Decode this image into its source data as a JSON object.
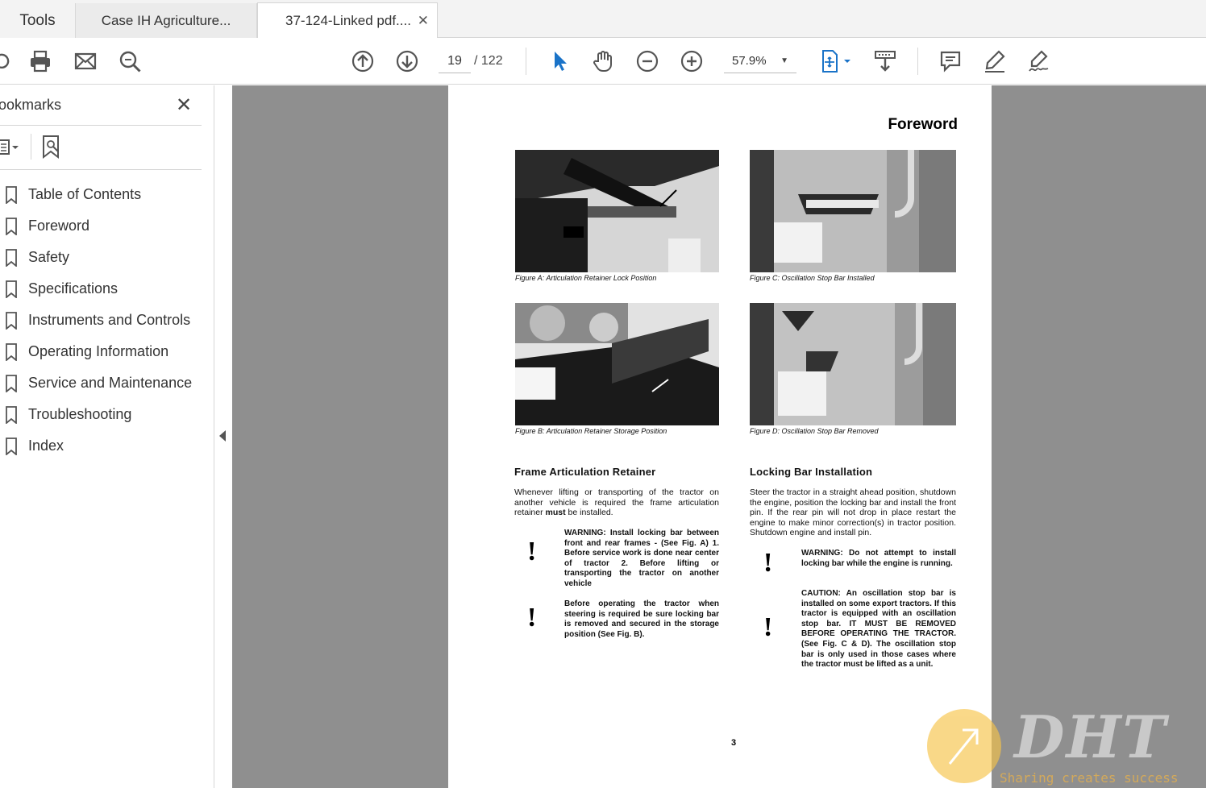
{
  "tabs": [
    {
      "label": "Tools"
    },
    {
      "label": "Case IH Agriculture..."
    },
    {
      "label": "37-124-Linked pdf...."
    }
  ],
  "toolbar": {
    "page_current": "19",
    "page_total": "/ 122",
    "zoom": "57.9%",
    "icons": [
      "share-icon",
      "print-icon",
      "email-icon",
      "search-zoom-icon",
      "page-up-icon",
      "page-down-icon",
      "select-tool-icon",
      "hand-tool-icon",
      "zoom-out-icon",
      "zoom-in-icon",
      "fit-page-icon",
      "scroll-mode-icon",
      "comment-icon",
      "highlight-icon",
      "sign-icon"
    ]
  },
  "sidebar": {
    "title": "ookmarks",
    "bookmarks": [
      {
        "label": "Table of Contents"
      },
      {
        "label": "Foreword"
      },
      {
        "label": "Safety"
      },
      {
        "label": "Specifications"
      },
      {
        "label": "Instruments and Controls"
      },
      {
        "label": "Operating Information"
      },
      {
        "label": "Service and Maintenance"
      },
      {
        "label": "Troubleshooting"
      },
      {
        "label": "Index"
      }
    ]
  },
  "document": {
    "title": "Foreword",
    "figures": [
      {
        "caption": "Figure A: Articulation Retainer Lock Position"
      },
      {
        "caption": "Figure C: Oscillation Stop Bar Installed"
      },
      {
        "caption": "Figure B: Articulation Retainer Storage Position"
      },
      {
        "caption": "Figure D: Oscillation Stop Bar Removed"
      }
    ],
    "left": {
      "heading": "Frame Articulation Retainer",
      "para_a": "Whenever lifting or transporting of the tractor on another vehicle is required the frame articulation retainer ",
      "para_bold": "must",
      "para_b": " be installed.",
      "warn1": "WARNING: Install locking bar between front and rear frames - (See Fig. A) 1. Before service work is done near center of tractor 2. Before lifting or transporting the tractor on another vehicle",
      "warn2": "Before operating the tractor when steering is required be sure locking bar is removed and secured in the storage position (See Fig. B)."
    },
    "right": {
      "heading": "Locking Bar Installation",
      "para": "Steer the tractor in a straight ahead position, shutdown the engine, position the locking bar and install the front pin. If the rear pin will not drop in place restart the engine to make minor correction(s) in tractor position. Shutdown engine and install pin.",
      "warn1": "WARNING: Do not attempt to install locking bar while the engine is running.",
      "caution": "CAUTION: An oscillation stop bar is installed on some export tractors. If this tractor is equipped with an oscillation stop bar. IT MUST BE REMOVED BEFORE OPERATING THE TRACTOR. (See Fig. C & D). The oscillation stop bar is only used in those cases where the tractor must be lifted as a unit."
    },
    "page_number": "3"
  },
  "watermark": {
    "text": "DHT",
    "subtitle": "Sharing creates success"
  }
}
